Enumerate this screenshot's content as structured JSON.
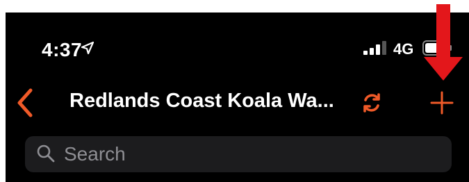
{
  "status_bar": {
    "time": "4:37",
    "location_icon": "location-arrow-icon",
    "signal_icon": "cellular-signal-icon",
    "network": "4G",
    "battery_icon": "battery-icon"
  },
  "nav": {
    "back_icon": "chevron-left-icon",
    "title": "Redlands Coast Koala Wa...",
    "refresh_icon": "refresh-icon",
    "add_icon": "plus-icon"
  },
  "search": {
    "icon": "search-icon",
    "placeholder": "Search"
  },
  "annotation": {
    "icon": "red-arrow-down-icon"
  },
  "colors": {
    "accent": "#f05a28",
    "background": "#000000",
    "search_field": "#1c1c1e",
    "annotation": "#e3171b"
  }
}
